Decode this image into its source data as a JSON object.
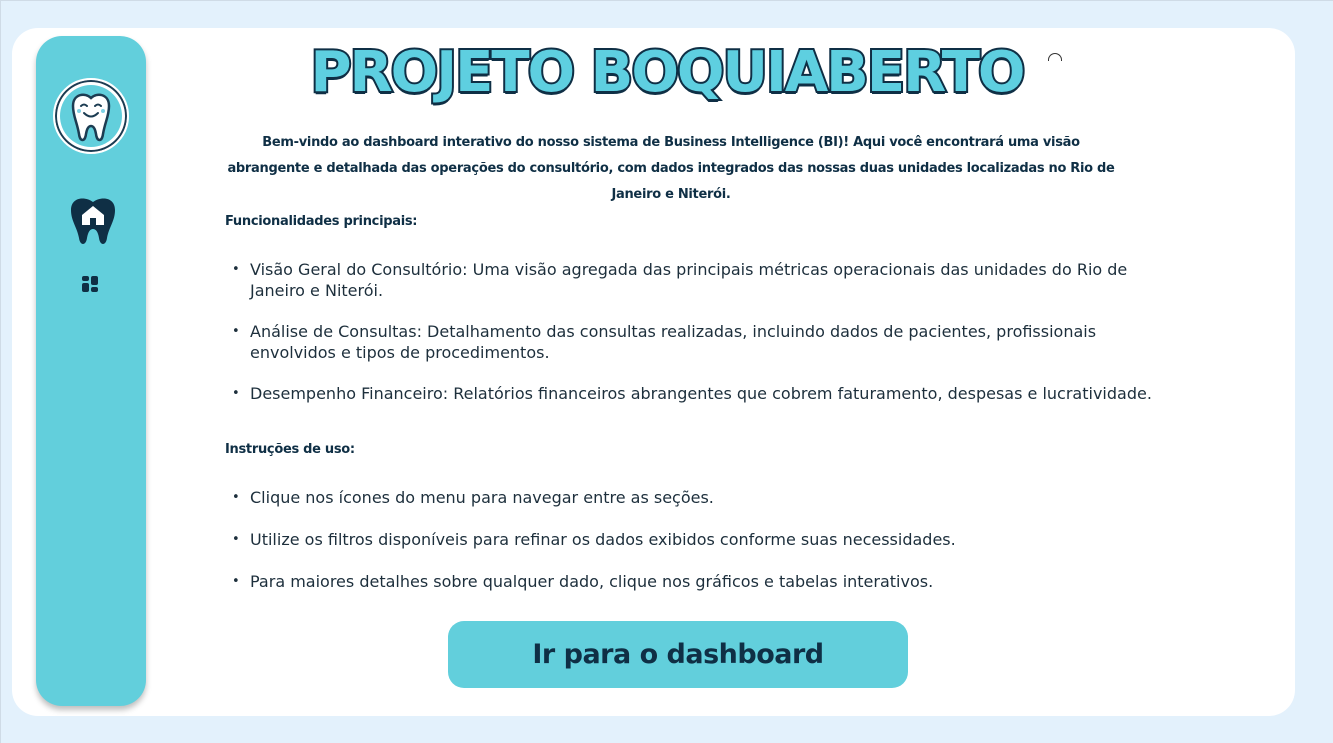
{
  "header": {
    "title": "PROJETO BOQUIABERTO"
  },
  "sidebar": {
    "logo_icon": "smiling-tooth-logo",
    "items": [
      {
        "name": "home",
        "icon": "tooth-home-icon"
      },
      {
        "name": "pages",
        "icon": "apps-icon"
      }
    ]
  },
  "intro": {
    "text": "Bem-vindo ao dashboard interativo do nosso sistema de Business Intelligence (BI)! Aqui você encontrará uma visão abrangente e detalhada das operações do consultório, com dados integrados das nossas duas unidades localizadas no Rio de Janeiro e Niterói."
  },
  "features": {
    "heading": "Funcionalidades principais:",
    "items": [
      "Visão Geral do Consultório: Uma visão agregada das principais métricas operacionais das unidades do Rio de Janeiro e Niterói.",
      "Análise de Consultas: Detalhamento das consultas realizadas, incluindo dados de pacientes, profissionais envolvidos e tipos de procedimentos.",
      "Desempenho Financeiro: Relatórios financeiros abrangentes que cobrem faturamento, despesas e lucratividade."
    ]
  },
  "instructions": {
    "heading": "Instruções de uso:",
    "items": [
      "Clique nos ícones do menu para navegar entre as seções.",
      "Utilize os filtros disponíveis para refinar os dados exibidos conforme suas necessidades.",
      "Para maiores detalhes sobre qualquer dado, clique nos gráficos e tabelas interativos."
    ]
  },
  "cta": {
    "label": "Ir para o dashboard"
  },
  "colors": {
    "accent": "#62cfdc",
    "navy": "#0f2f45",
    "background": "#e3f1fc",
    "card": "#ffffff"
  }
}
